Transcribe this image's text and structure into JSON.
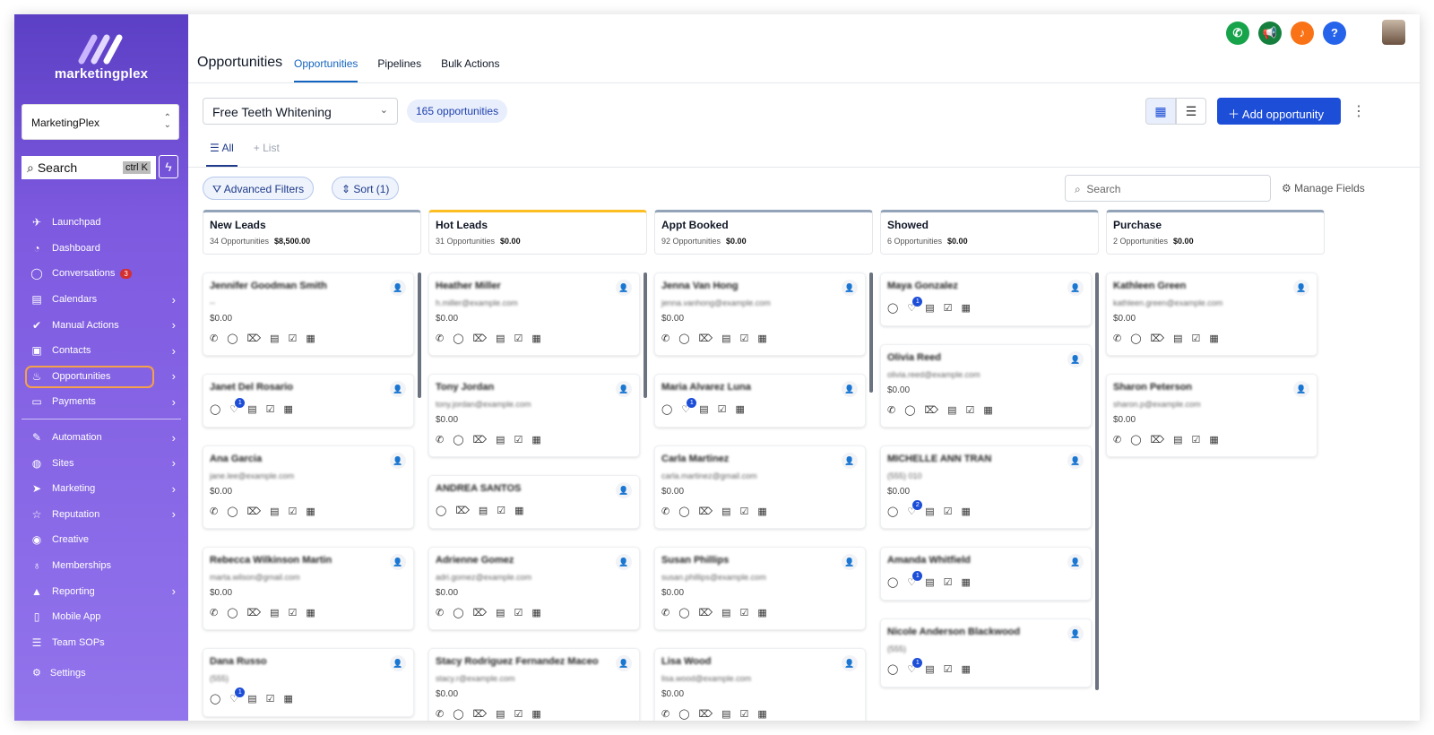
{
  "sidebar": {
    "logo_text": "marketingplex",
    "account": "MarketingPlex",
    "search_label": "Search",
    "search_shortcut": "ctrl K",
    "items": [
      {
        "label": "Launchpad",
        "icon": "rocket-icon",
        "arrow": false
      },
      {
        "label": "Dashboard",
        "icon": "gauge-icon",
        "arrow": false
      },
      {
        "label": "Conversations",
        "icon": "chat-icon",
        "arrow": false,
        "badge": "3"
      },
      {
        "label": "Calendars",
        "icon": "calendar-icon",
        "arrow": true
      },
      {
        "label": "Manual Actions",
        "icon": "check-circle-icon",
        "arrow": true
      },
      {
        "label": "Contacts",
        "icon": "contacts-icon",
        "arrow": true
      },
      {
        "label": "Opportunities",
        "icon": "flame-icon",
        "arrow": true,
        "active": true
      },
      {
        "label": "Payments",
        "icon": "card-icon",
        "arrow": true
      },
      {
        "label": "Automation",
        "icon": "wand-icon",
        "arrow": true
      },
      {
        "label": "Sites",
        "icon": "globe-icon",
        "arrow": true
      },
      {
        "label": "Marketing",
        "icon": "send-icon",
        "arrow": true
      },
      {
        "label": "Reputation",
        "icon": "star-icon",
        "arrow": true
      },
      {
        "label": "Creative",
        "icon": "palette-icon",
        "arrow": false
      },
      {
        "label": "Memberships",
        "icon": "award-icon",
        "arrow": false
      },
      {
        "label": "Reporting",
        "icon": "chart-icon",
        "arrow": true
      },
      {
        "label": "Mobile App",
        "icon": "phone-icon",
        "arrow": false
      },
      {
        "label": "Team SOPs",
        "icon": "list-icon",
        "arrow": false
      }
    ],
    "settings": "Settings"
  },
  "header": {
    "title": "Opportunities",
    "tabs": [
      "Opportunities",
      "Pipelines",
      "Bulk Actions"
    ],
    "icon_colors": {
      "phone": "#16a34a",
      "megaphone": "#15803d",
      "bell": "#f97316",
      "help": "#2563eb"
    }
  },
  "toolbar": {
    "pipeline": "Free Teeth Whitening",
    "count": "165 opportunities",
    "add_button": "Add opportunity",
    "subtab_all": "All",
    "subtab_list": "List",
    "advanced_filters": "Advanced Filters",
    "sort": "Sort (1)",
    "search_placeholder": "Search",
    "manage_fields": "Manage Fields"
  },
  "columns": [
    {
      "name": "New Leads",
      "count": "34 Opportunities",
      "amount": "$8,500.00",
      "cards": [
        {
          "name": "Jennifer Goodman Smith",
          "email": "--",
          "value": "$0.00",
          "icons": "full"
        },
        {
          "name": "Janet Del Rosario",
          "email": "",
          "value": "",
          "icons": "badge",
          "badge": "1"
        },
        {
          "name": "Ana Garcia",
          "email": "jane.lee@example.com",
          "value": "$0.00",
          "icons": "full"
        },
        {
          "name": "Rebecca Wilkinson Martin",
          "email": "marta.wilson@gmail.com",
          "value": "$0.00",
          "icons": "full"
        },
        {
          "name": "Dana Russo",
          "email": "(555)",
          "value": "",
          "icons": "badge",
          "badge": "1"
        }
      ]
    },
    {
      "name": "Hot Leads",
      "count": "31 Opportunities",
      "amount": "$0.00",
      "cards": [
        {
          "name": "Heather Miller",
          "email": "h.miller@example.com",
          "value": "$0.00",
          "icons": "full"
        },
        {
          "name": "Tony Jordan",
          "email": "tony.jordan@example.com",
          "value": "$0.00",
          "icons": "full"
        },
        {
          "name": "ANDREA SANTOS",
          "email": "",
          "value": "",
          "icons": "noPhone"
        },
        {
          "name": "Adrienne Gomez",
          "email": "adri.gomez@example.com",
          "value": "$0.00",
          "icons": "full"
        },
        {
          "name": "Stacy Rodriguez Fernandez Maceo",
          "email": "stacy.r@example.com",
          "value": "$0.00",
          "icons": "full"
        }
      ]
    },
    {
      "name": "Appt Booked",
      "count": "92 Opportunities",
      "amount": "$0.00",
      "cards": [
        {
          "name": "Jenna Van Hong",
          "email": "jenna.vanhong@example.com",
          "value": "$0.00",
          "icons": "full"
        },
        {
          "name": "Maria Alvarez Luna",
          "email": "",
          "value": "",
          "icons": "badge",
          "badge": "1"
        },
        {
          "name": "Carla Martinez",
          "email": "carla.martinez@gmail.com",
          "value": "$0.00",
          "icons": "full"
        },
        {
          "name": "Susan Phillips",
          "email": "susan.phillips@example.com",
          "value": "$0.00",
          "icons": "full"
        },
        {
          "name": "Lisa Wood",
          "email": "lisa.wood@example.com",
          "value": "$0.00",
          "icons": "full"
        }
      ]
    },
    {
      "name": "Showed",
      "count": "6 Opportunities",
      "amount": "$0.00",
      "cards": [
        {
          "name": "Maya Gonzalez",
          "email": "",
          "value": "",
          "icons": "badge",
          "badge": "1"
        },
        {
          "name": "Olivia Reed",
          "email": "olivia.reed@example.com",
          "value": "$0.00",
          "icons": "full"
        },
        {
          "name": "MICHELLE ANN TRAN",
          "email": "(555) 010",
          "value": "$0.00",
          "icons": "badge",
          "badge": "2"
        },
        {
          "name": "Amanda Whitfield",
          "email": "",
          "value": "",
          "icons": "badge",
          "badge": "1"
        },
        {
          "name": "Nicole Anderson Blackwood",
          "email": "(555)",
          "value": "",
          "icons": "badge",
          "badge": "1"
        }
      ]
    },
    {
      "name": "Purchase",
      "count": "2 Opportunities",
      "amount": "$0.00",
      "cards": [
        {
          "name": "Kathleen Green",
          "email": "kathleen.green@example.com",
          "value": "$0.00",
          "icons": "full"
        },
        {
          "name": "Sharon Peterson",
          "email": "sharon.p@example.com",
          "value": "$0.00",
          "icons": "full"
        }
      ]
    }
  ]
}
